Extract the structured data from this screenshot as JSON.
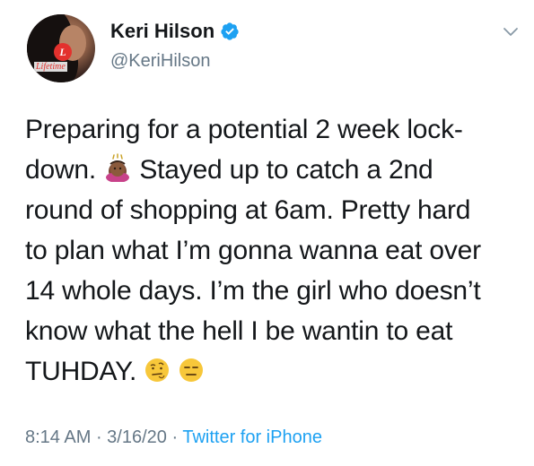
{
  "user": {
    "name": "Keri Hilson",
    "handle": "@KeriHilson",
    "avatar_logo": "Lifetime",
    "verified_icon": "verified-badge-icon",
    "menu_icon": "chevron-down-icon"
  },
  "tweet": {
    "lines": [
      "Preparing for a potential 2 week lock-",
      "down.",
      "Stayed up to catch a 2nd",
      "round of shopping at 6am. Pretty hard",
      "to plan what I’m gonna wanna eat over",
      "14 whole days. I’m the girl who doesn’t",
      "know what the hell I be wantin to eat",
      "TUHDAY."
    ],
    "emojis": [
      "woman-exploding-head-emoji",
      "raised-eyebrow-face-emoji",
      "expressionless-face-emoji"
    ]
  },
  "meta": {
    "time": "8:14 AM",
    "sep1": " · ",
    "date": "3/16/20",
    "sep2": " · ",
    "source": "Twitter for iPhone"
  },
  "colors": {
    "text": "#14171a",
    "secondary": "#657786",
    "link": "#1da1f2",
    "verified": "#1da1f2"
  }
}
